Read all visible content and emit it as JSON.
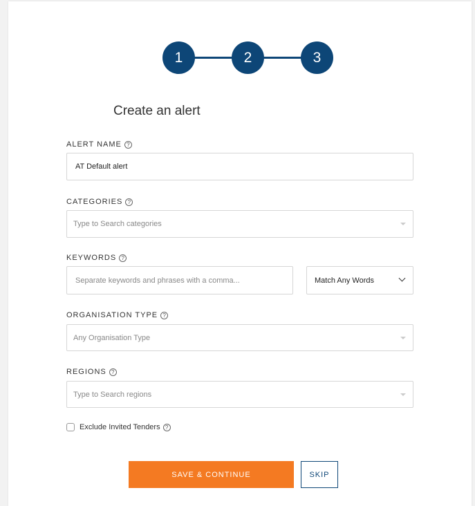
{
  "colors": {
    "primary": "#0d4677",
    "accent": "#f47a22"
  },
  "stepper": {
    "steps": [
      "1",
      "2",
      "3"
    ]
  },
  "title": "Create an alert",
  "form": {
    "alert_name": {
      "label": "ALERT NAME",
      "value": "AT Default alert"
    },
    "categories": {
      "label": "CATEGORIES",
      "placeholder": "Type to Search categories"
    },
    "keywords": {
      "label": "KEYWORDS",
      "placeholder": "Separate keywords and phrases with a comma...",
      "match_selected": "Match Any Words"
    },
    "organisation_type": {
      "label": "ORGANISATION TYPE",
      "placeholder": "Any Organisation Type"
    },
    "regions": {
      "label": "REGIONS",
      "placeholder": "Type to Search regions"
    },
    "exclude_invited": {
      "label": "Exclude Invited Tenders",
      "checked": false
    }
  },
  "help_icon": "?",
  "actions": {
    "save": "SAVE & CONTINUE",
    "skip": "SKIP"
  }
}
